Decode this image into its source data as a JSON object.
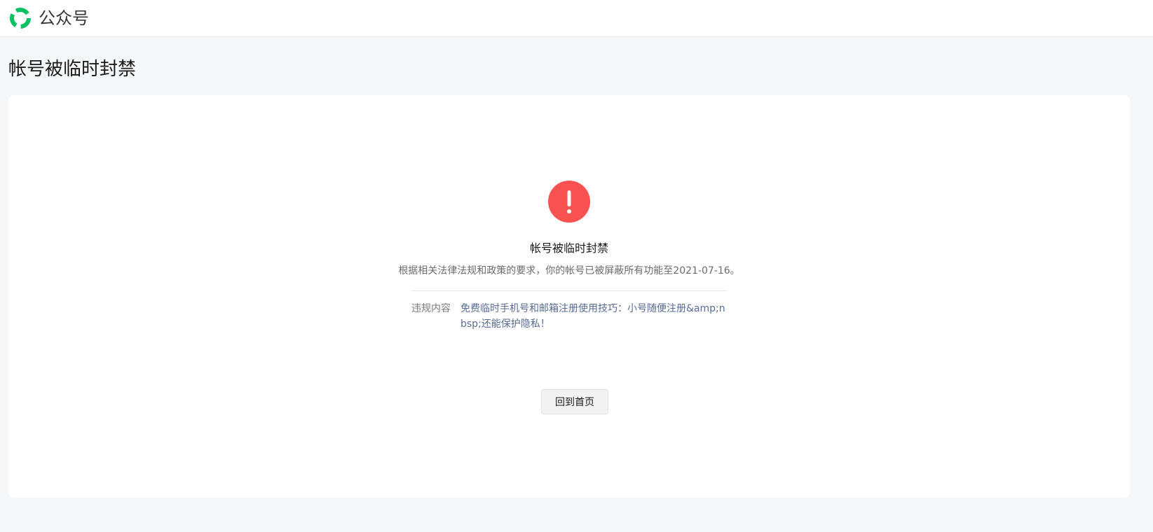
{
  "header": {
    "brand_name": "公众号",
    "logo_icon": "wechat-official-account-logo-icon",
    "logo_color": "#07c160"
  },
  "page": {
    "title": "帐号被临时封禁"
  },
  "notice": {
    "status_icon": "exclamation-icon",
    "status_color": "#fa5151",
    "title": "帐号被临时封禁",
    "description": "根据相关法律法规和政策的要求，你的帐号已被屏蔽所有功能至2021-07-16。",
    "detail_label": "违规内容",
    "detail_value": "免费临时手机号和邮箱注册使用技巧：小号随便注册&amp;nbsp;还能保护隐私！",
    "home_button_label": "回到首页"
  }
}
